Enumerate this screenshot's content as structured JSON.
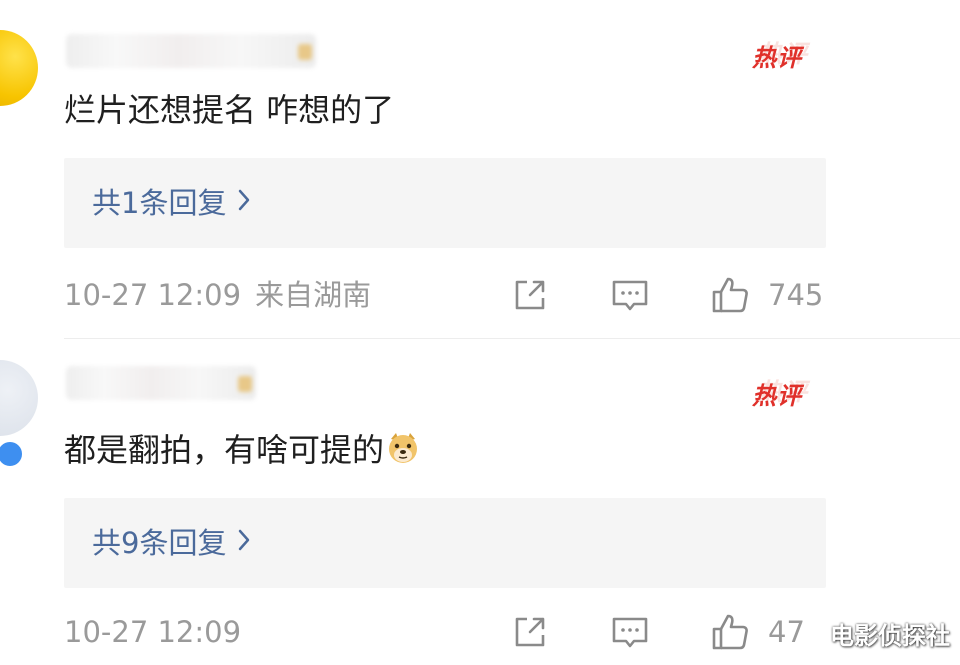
{
  "colors": {
    "hot_badge": "#e0302a",
    "reply_link": "#4b6a9b",
    "meta_text": "#9a9a9a",
    "body_text": "#1f1f1f",
    "reply_box_bg": "#f5f5f5"
  },
  "comments": [
    {
      "username": "",
      "avatar_icon": "avatar-sunglasses-icon",
      "hot_badge": "热评",
      "text": "烂片还想提名 咋想的了",
      "emoji": "",
      "replies_label": "共1条回复",
      "date": "10-27 12:09",
      "location": "来自湖南",
      "share_icon": "share-icon",
      "comment_icon": "comment-icon",
      "like_icon": "like-icon",
      "like_count": "745"
    },
    {
      "username": "",
      "avatar_icon": "avatar-icon",
      "hot_badge": "热评",
      "text": "都是翻拍，有啥可提的",
      "emoji": "doge-emoji-icon",
      "replies_label": "共9条回复",
      "date": "10-27 12:09",
      "location": "",
      "share_icon": "share-icon",
      "comment_icon": "comment-icon",
      "like_icon": "like-icon",
      "like_count": "47"
    }
  ],
  "watermark": "电影侦探社"
}
